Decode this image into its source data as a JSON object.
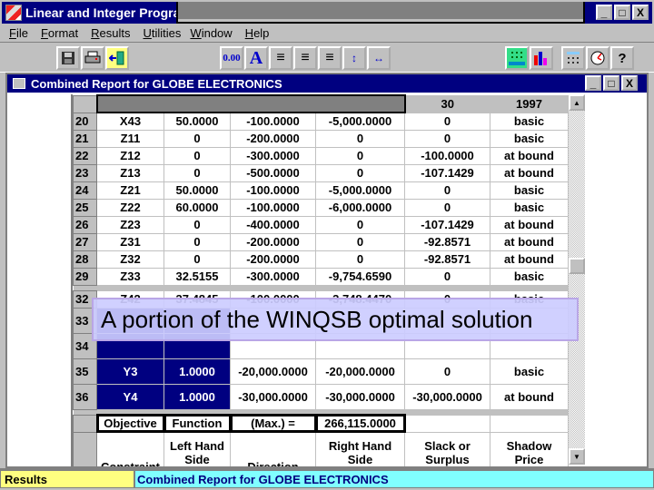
{
  "app": {
    "title": "Linear and Integer Progra",
    "window_controls": [
      "_",
      "□",
      "X"
    ]
  },
  "menu": [
    "File",
    "Format",
    "Results",
    "Utilities",
    "Window",
    "Help"
  ],
  "toolbar": {
    "left": [
      "save-icon",
      "print-icon",
      "exit-icon"
    ],
    "format": [
      {
        "icon": "number-format-icon",
        "label": "0.00"
      },
      {
        "icon": "font-icon",
        "label": "A"
      },
      {
        "icon": "align-left-icon",
        "label": "≡"
      },
      {
        "icon": "align-center-icon",
        "label": "≡"
      },
      {
        "icon": "align-right-icon",
        "label": "≡"
      },
      {
        "icon": "row-height-icon",
        "label": "↕"
      },
      {
        "icon": "column-width-icon",
        "label": "↔"
      }
    ],
    "right": [
      "grid-icon",
      "bar-chart-icon",
      "calculator-icon",
      "clock-icon",
      "help-icon"
    ]
  },
  "report": {
    "title": "Combined Report for GLOBE ELECTRONICS",
    "header": {
      "col5": "30",
      "col6": "1997"
    },
    "rows": [
      {
        "n": "20",
        "var": "X43",
        "val": "50.0000",
        "cost": "-100.0000",
        "contrib": "-5,000.0000",
        "reduced": "0",
        "status": "basic"
      },
      {
        "n": "21",
        "var": "Z11",
        "val": "0",
        "cost": "-200.0000",
        "contrib": "0",
        "reduced": "0",
        "status": "basic"
      },
      {
        "n": "22",
        "var": "Z12",
        "val": "0",
        "cost": "-300.0000",
        "contrib": "0",
        "reduced": "-100.0000",
        "status": "at bound"
      },
      {
        "n": "23",
        "var": "Z13",
        "val": "0",
        "cost": "-500.0000",
        "contrib": "0",
        "reduced": "-107.1429",
        "status": "at bound"
      },
      {
        "n": "24",
        "var": "Z21",
        "val": "50.0000",
        "cost": "-100.0000",
        "contrib": "-5,000.0000",
        "reduced": "0",
        "status": "basic"
      },
      {
        "n": "25",
        "var": "Z22",
        "val": "60.0000",
        "cost": "-100.0000",
        "contrib": "-6,000.0000",
        "reduced": "0",
        "status": "basic"
      },
      {
        "n": "26",
        "var": "Z23",
        "val": "0",
        "cost": "-400.0000",
        "contrib": "0",
        "reduced": "-107.1429",
        "status": "at bound"
      },
      {
        "n": "27",
        "var": "Z31",
        "val": "0",
        "cost": "-200.0000",
        "contrib": "0",
        "reduced": "-92.8571",
        "status": "at bound"
      },
      {
        "n": "28",
        "var": "Z32",
        "val": "0",
        "cost": "-200.0000",
        "contrib": "0",
        "reduced": "-92.8571",
        "status": "at bound"
      },
      {
        "n": "29",
        "var": "Z33",
        "val": "32.5155",
        "cost": "-300.0000",
        "contrib": "-9,754.6590",
        "reduced": "0",
        "status": "basic"
      }
    ],
    "partial_rows": [
      {
        "n": "32",
        "var": "Z42",
        "val": "37.4845",
        "cost": "-100.0000",
        "contrib": "-3,748.4470",
        "reduced": "0",
        "status": "basic"
      },
      {
        "n": "33"
      },
      {
        "n": "34"
      }
    ],
    "selected_rows": [
      {
        "n": "35",
        "var": "Y3",
        "val": "1.0000",
        "cost": "-20,000.0000",
        "contrib": "-20,000.0000",
        "reduced": "0",
        "status": "basic"
      },
      {
        "n": "36",
        "var": "Y4",
        "val": "1.0000",
        "cost": "-30,000.0000",
        "contrib": "-30,000.0000",
        "reduced": "-30,000.0000",
        "status": "at bound"
      }
    ],
    "objective": {
      "label1": "Objective",
      "label2": "Function",
      "label3": "(Max.) =",
      "value": "266,115.0000"
    },
    "constraint_header": [
      "Constraint",
      "Left Hand Side",
      "Direction",
      "Right Hand Side",
      "Slack or Surplus",
      "Shadow Price"
    ]
  },
  "overlay_caption": "A portion of the WINQSB optimal solution",
  "status": {
    "left": "Results",
    "right": "Combined Report for GLOBE ELECTRONICS"
  }
}
